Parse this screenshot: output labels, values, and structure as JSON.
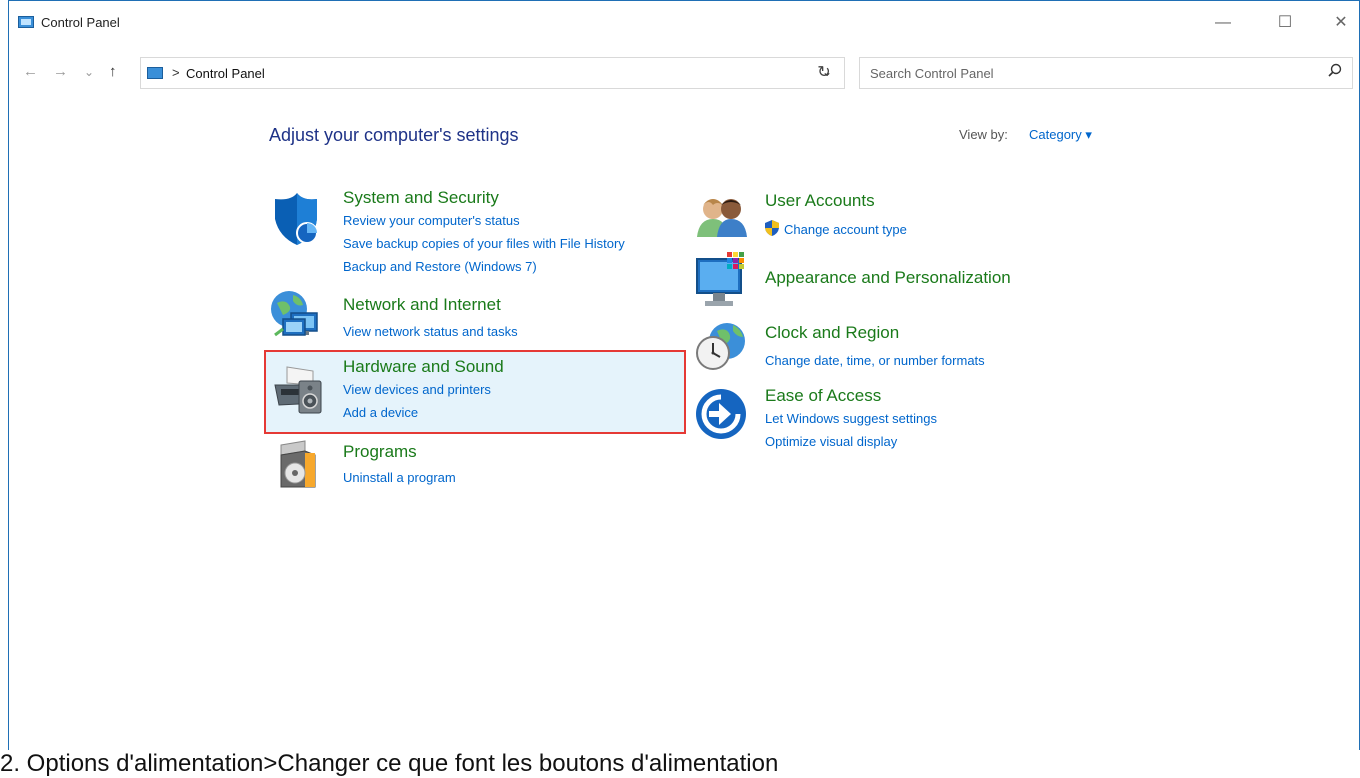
{
  "window": {
    "title": "Control Panel"
  },
  "controls": {
    "minimize": "—",
    "maximize": "☐",
    "close": "✕"
  },
  "nav": {
    "back": "←",
    "forward": "→",
    "recent": "⌄",
    "up": "↑"
  },
  "address": {
    "separator": ">",
    "path": "Control Panel",
    "dropdown": "⌄",
    "refresh": "↻"
  },
  "search": {
    "placeholder": "Search Control Panel"
  },
  "main": {
    "heading": "Adjust your computer's settings",
    "view_by_label": "View by:",
    "view_by_value": "Category ▾"
  },
  "categories": {
    "system_security": {
      "title": "System and Security",
      "links": [
        "Review your computer's status",
        "Save backup copies of your files with File History",
        "Backup and Restore (Windows 7)"
      ]
    },
    "network": {
      "title": "Network and Internet",
      "links": [
        "View network status and tasks"
      ]
    },
    "hardware": {
      "title": "Hardware and Sound",
      "links": [
        "View devices and printers",
        "Add a device"
      ]
    },
    "programs": {
      "title": "Programs",
      "links": [
        "Uninstall a program"
      ]
    },
    "user_accounts": {
      "title": "User Accounts",
      "links": [
        "Change account type"
      ]
    },
    "appearance": {
      "title": "Appearance and Personalization",
      "links": []
    },
    "clock": {
      "title": "Clock and Region",
      "links": [
        "Change date, time, or number formats"
      ]
    },
    "ease": {
      "title": "Ease of Access",
      "links": [
        "Let Windows suggest settings",
        "Optimize visual display"
      ]
    }
  },
  "caption": "2. Options d'alimentation>Changer ce que font les boutons d'alimentation"
}
